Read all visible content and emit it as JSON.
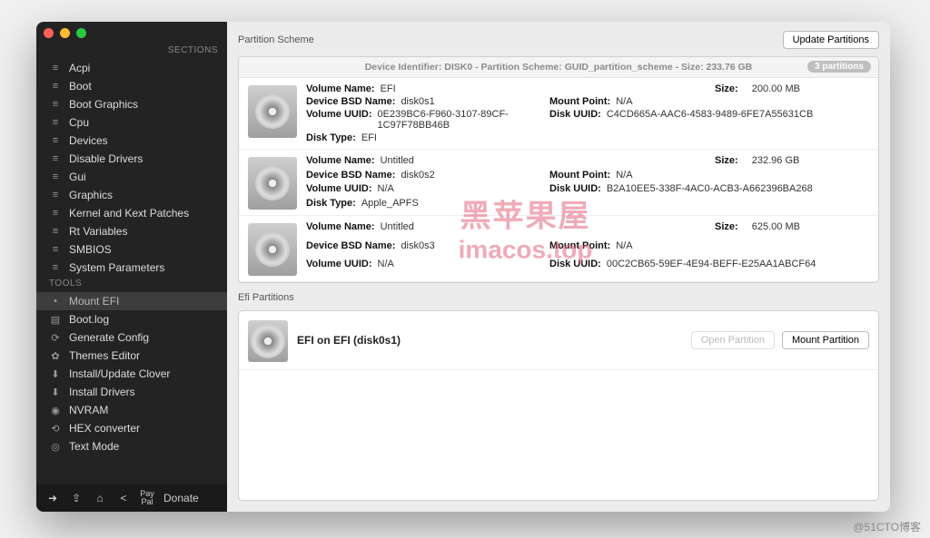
{
  "sidebar": {
    "sections_label": "SECTIONS",
    "tools_label": "TOOLS",
    "sections": [
      {
        "label": "Acpi"
      },
      {
        "label": "Boot"
      },
      {
        "label": "Boot Graphics"
      },
      {
        "label": "Cpu"
      },
      {
        "label": "Devices"
      },
      {
        "label": "Disable Drivers"
      },
      {
        "label": "Gui"
      },
      {
        "label": "Graphics"
      },
      {
        "label": "Kernel and Kext Patches"
      },
      {
        "label": "Rt Variables"
      },
      {
        "label": "SMBIOS"
      },
      {
        "label": "System Parameters"
      }
    ],
    "tools": [
      {
        "label": "Mount EFI",
        "selected": true
      },
      {
        "label": "Boot.log"
      },
      {
        "label": "Generate Config"
      },
      {
        "label": "Themes Editor"
      },
      {
        "label": "Install/Update Clover"
      },
      {
        "label": "Install Drivers"
      },
      {
        "label": "NVRAM"
      },
      {
        "label": "HEX converter"
      },
      {
        "label": "Text Mode"
      }
    ],
    "donate": "Donate"
  },
  "main": {
    "partition_scheme_label": "Partition Scheme",
    "update_btn": "Update Partitions",
    "efi_partitions_label": "Efi Partitions",
    "open_partition_btn": "Open Partition",
    "mount_partition_btn": "Mount Partition"
  },
  "disk": {
    "meta": "Device Identifier: DISK0 - Partition Scheme: GUID_partition_scheme - Size: 233.76 GB",
    "badge": "3 partitions",
    "labels": {
      "volume_name": "Volume Name:",
      "bsd": "Device BSD Name:",
      "uuid": "Volume UUID:",
      "disk_type": "Disk Type:",
      "mount": "Mount Point:",
      "disk_uuid": "Disk UUID:",
      "size": "Size:"
    },
    "parts": [
      {
        "name": "EFI",
        "bsd": "disk0s1",
        "uuid": "0E239BC6-F960-3107-89CF-1C97F78BB46B",
        "type": "EFI",
        "mount": "N/A",
        "disk_uuid": "C4CD665A-AAC6-4583-9489-6FE7A55631CB",
        "size": "200.00 MB"
      },
      {
        "name": "Untitled",
        "bsd": "disk0s2",
        "uuid": "N/A",
        "type": "Apple_APFS",
        "mount": "N/A",
        "disk_uuid": "B2A10EE5-338F-4AC0-ACB3-A662396BA268",
        "size": "232.96 GB"
      },
      {
        "name": "Untitled",
        "bsd": "disk0s3",
        "uuid": "N/A",
        "type": "",
        "mount": "N/A",
        "disk_uuid": "00C2CB65-59EF-4E94-BEFF-E25AA1ABCF64",
        "size": "625.00 MB"
      }
    ]
  },
  "efi": {
    "title": "EFI on EFI (disk0s1)"
  },
  "watermark": {
    "cn": "黑苹果屋",
    "url": "imacos.top"
  },
  "credits": "@51CTO博客"
}
